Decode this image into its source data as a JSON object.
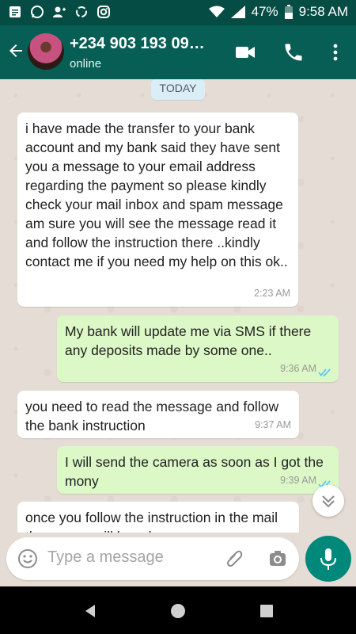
{
  "status_bar": {
    "battery": "47%",
    "time": "9:58 AM"
  },
  "header": {
    "contact_name": "+234 903 193 09…",
    "status": "online"
  },
  "date_chip": "TODAY",
  "messages": [
    {
      "direction": "in",
      "text": "i have made the transfer to your bank account and my bank said they have sent you a message to your email address regarding the payment so please kindly check your mail inbox and spam message am sure you will see the message read it and follow the instruction there ..kindly contact me if you need my help on this ok..",
      "time": "2:23 AM"
    },
    {
      "direction": "out",
      "text": "My bank will update me via SMS if there any deposits made by some one..",
      "time": "9:36 AM"
    },
    {
      "direction": "in",
      "text": "you need to read the message and follow the bank instruction",
      "time": "9:37 AM"
    },
    {
      "direction": "out",
      "text": "I will send the camera as soon as I got the mony",
      "time": "9:39 AM"
    },
    {
      "direction": "in",
      "text": "once you follow the instruction in the mail the money will be release",
      "time": ""
    }
  ],
  "composer": {
    "placeholder": "Type a message"
  },
  "colors": {
    "header": "#075e54",
    "outgoing": "#dcf8c6",
    "incoming": "#ffffff",
    "fab": "#00897b",
    "read_ticks": "#4fc3f7"
  },
  "icons": [
    "back-arrow-icon",
    "video-call-icon",
    "phone-icon",
    "more-vert-icon",
    "emoji-icon",
    "attach-icon",
    "camera-icon",
    "mic-icon",
    "chevron-down-icon"
  ]
}
